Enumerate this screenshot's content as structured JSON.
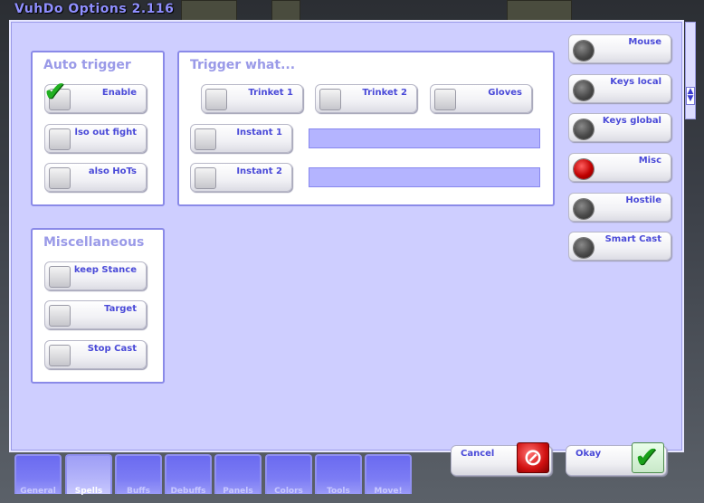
{
  "window": {
    "title": "VuhDo Options 2.116"
  },
  "auto_trigger": {
    "title": "Auto trigger",
    "items": [
      {
        "label": "Enable",
        "checked": true
      },
      {
        "label": "lso out fight",
        "checked": false
      },
      {
        "label": "also HoTs",
        "checked": false
      }
    ]
  },
  "trigger_what": {
    "title": "Trigger what...",
    "items": [
      {
        "label": "Trinket 1",
        "checked": false
      },
      {
        "label": "Trinket 2",
        "checked": false
      },
      {
        "label": "Gloves",
        "checked": false
      },
      {
        "label": "Instant 1",
        "checked": false,
        "value": ""
      },
      {
        "label": "Instant 2",
        "checked": false,
        "value": ""
      }
    ]
  },
  "misc": {
    "title": "Miscellaneous",
    "items": [
      {
        "label": "keep Stance",
        "checked": false
      },
      {
        "label": "Target",
        "checked": false
      },
      {
        "label": "Stop Cast",
        "checked": false
      }
    ]
  },
  "side_menu": {
    "items": [
      {
        "label": "Mouse",
        "selected": false
      },
      {
        "label": "Keys local",
        "selected": false
      },
      {
        "label": "Keys global",
        "selected": false
      },
      {
        "label": "Misc",
        "selected": true
      },
      {
        "label": "Hostile",
        "selected": false
      },
      {
        "label": "Smart Cast",
        "selected": false
      }
    ]
  },
  "footer": {
    "cancel_label": "Cancel",
    "okay_label": "Okay"
  },
  "tabs": [
    {
      "label": "General",
      "selected": false
    },
    {
      "label": "Spells",
      "selected": true
    },
    {
      "label": "Buffs",
      "selected": false
    },
    {
      "label": "Debuffs",
      "selected": false
    },
    {
      "label": "Panels",
      "selected": false
    },
    {
      "label": "Colors",
      "selected": false
    },
    {
      "label": "Tools",
      "selected": false
    },
    {
      "label": "Move!",
      "selected": false
    }
  ],
  "colors": {
    "frame": "#ceceff",
    "accent": "#4a4ad8",
    "title": "#9a9ae8",
    "radio_selected": "#c00000"
  }
}
